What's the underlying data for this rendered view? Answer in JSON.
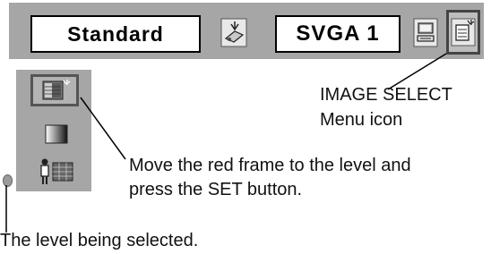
{
  "menu_bar": {
    "mode_label": "Standard",
    "resolution_label": "SVGA 1",
    "icons": [
      "projector-input-icon",
      "pc-adjust-icon",
      "image-select-icon"
    ]
  },
  "sidebar": {
    "icons": [
      "image-select-icon",
      "gradient-level-icon",
      "person-image-icon"
    ]
  },
  "annotations": {
    "image_select_line1": "IMAGE SELECT",
    "image_select_line2": "Menu icon",
    "move_line1": "Move the red frame to the level and",
    "move_line2": "press the SET button.",
    "level_selected": "The level being selected."
  },
  "colors": {
    "panel_gray": "#a6a6a6",
    "indicator": "#9a9a9a"
  }
}
